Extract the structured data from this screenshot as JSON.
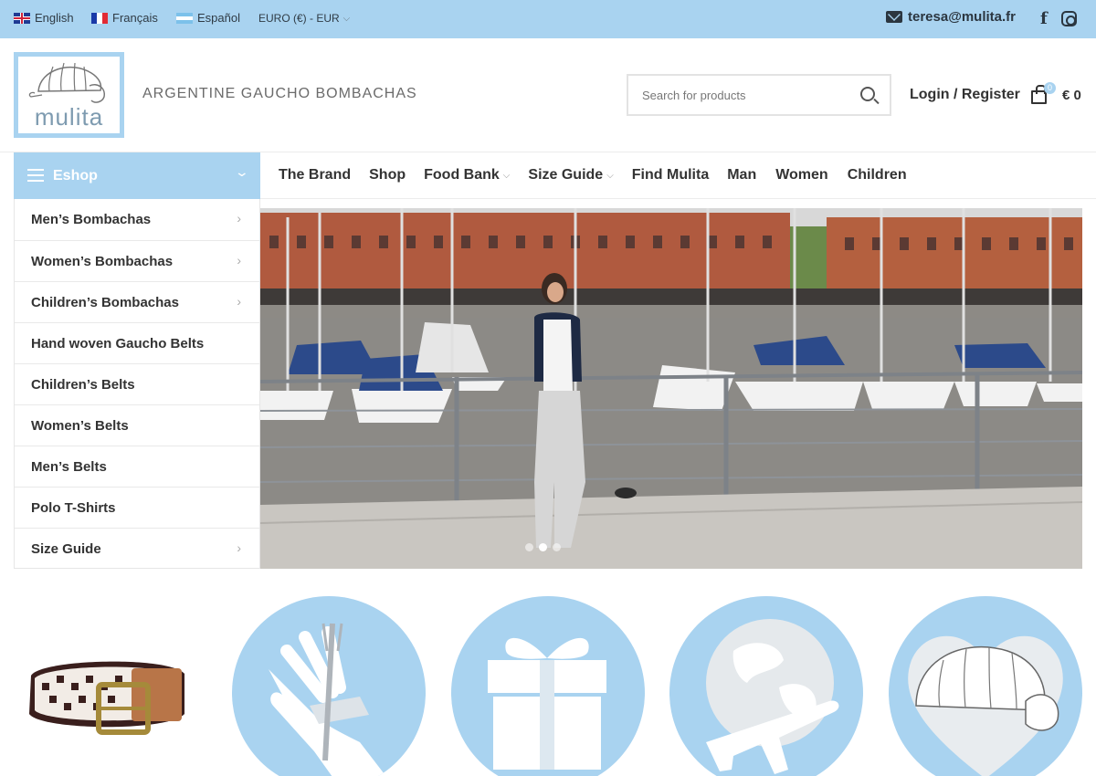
{
  "topbar": {
    "languages": [
      {
        "label": "English",
        "flag": "uk-flag-icon"
      },
      {
        "label": "Français",
        "flag": "france-flag-icon"
      },
      {
        "label": "Español",
        "flag": "argentina-flag-icon"
      }
    ],
    "currency": "EURO (€) - EUR",
    "email": "teresa@mulita.fr",
    "social": [
      {
        "icon": "facebook-icon",
        "glyph": "f"
      },
      {
        "icon": "instagram-icon"
      }
    ]
  },
  "header": {
    "logo_text": "mulita",
    "tagline": "ARGENTINE GAUCHO BOMBACHAS",
    "search": {
      "placeholder": "Search for products"
    },
    "login_label": "Login / Register",
    "cart": {
      "count": "0",
      "total": "€ 0"
    }
  },
  "nav": {
    "eshop_label": "Eshop",
    "items": [
      {
        "label": "The Brand",
        "dropdown": false
      },
      {
        "label": "Shop",
        "dropdown": false
      },
      {
        "label": "Food Bank",
        "dropdown": true
      },
      {
        "label": "Size Guide",
        "dropdown": true
      },
      {
        "label": "Find Mulita",
        "dropdown": false
      },
      {
        "label": "Man",
        "dropdown": false
      },
      {
        "label": "Women",
        "dropdown": false
      },
      {
        "label": "Children",
        "dropdown": false
      }
    ]
  },
  "categories": [
    {
      "label": "Men’s Bombachas",
      "has_submenu": true
    },
    {
      "label": "Women’s Bombachas",
      "has_submenu": true
    },
    {
      "label": "Children’s Bombachas",
      "has_submenu": true
    },
    {
      "label": "Hand woven Gaucho Belts",
      "has_submenu": false
    },
    {
      "label": "Children’s Belts",
      "has_submenu": false
    },
    {
      "label": "Women’s Belts",
      "has_submenu": false
    },
    {
      "label": "Men’s Belts",
      "has_submenu": false
    },
    {
      "label": "Polo T-Shirts",
      "has_submenu": false
    },
    {
      "label": "Size Guide",
      "has_submenu": true
    }
  ],
  "slider": {
    "slides": 3,
    "active": 2
  },
  "features": [
    "food-bank-icon",
    "gift-icon",
    "worldwide-shipping-icon",
    "mulita-heart-icon"
  ],
  "colors": {
    "brand_blue": "#a9d3f0",
    "text_dark": "#333333"
  }
}
